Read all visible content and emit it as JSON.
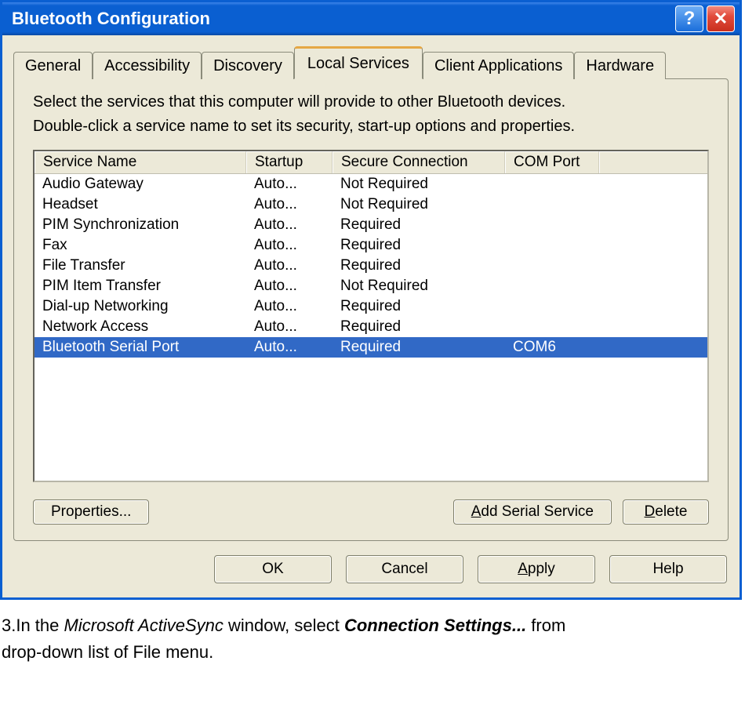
{
  "titlebar": {
    "title": "Bluetooth Configuration"
  },
  "tabs": {
    "general": "General",
    "accessibility": "Accessibility",
    "discovery": "Discovery",
    "local_services": "Local Services",
    "client_apps": "Client Applications",
    "hardware": "Hardware"
  },
  "panel": {
    "instruction1": "Select the services that this computer will provide to other Bluetooth devices.",
    "instruction2": "Double-click a service name to set its security, start-up options and properties.",
    "columns": {
      "name": "Service Name",
      "startup": "Startup",
      "secure": "Secure Connection",
      "port": "COM Port"
    },
    "services": [
      {
        "name": "Audio Gateway",
        "startup": "Auto...",
        "secure": "Not Required",
        "port": ""
      },
      {
        "name": "Headset",
        "startup": "Auto...",
        "secure": "Not Required",
        "port": ""
      },
      {
        "name": "PIM Synchronization",
        "startup": "Auto...",
        "secure": "Required",
        "port": ""
      },
      {
        "name": "Fax",
        "startup": "Auto...",
        "secure": "Required",
        "port": ""
      },
      {
        "name": "File Transfer",
        "startup": "Auto...",
        "secure": "Required",
        "port": ""
      },
      {
        "name": "PIM Item Transfer",
        "startup": "Auto...",
        "secure": "Not Required",
        "port": ""
      },
      {
        "name": "Dial-up Networking",
        "startup": "Auto...",
        "secure": "Required",
        "port": ""
      },
      {
        "name": "Network Access",
        "startup": "Auto...",
        "secure": "Required",
        "port": ""
      },
      {
        "name": "Bluetooth Serial Port",
        "startup": "Auto...",
        "secure": "Required",
        "port": "COM6",
        "selected": true
      }
    ],
    "buttons": {
      "properties": "Properties...",
      "add_serial": "Add Serial Service",
      "delete": "Delete"
    }
  },
  "dialog_buttons": {
    "ok": "OK",
    "cancel": "Cancel",
    "apply": "Apply",
    "help": "Help"
  },
  "caption": {
    "prefix": "3.In the ",
    "italic": "Microsoft ActiveSync",
    "mid": " window, select ",
    "bold": "Connection Settings...",
    "suffix1": " from",
    "suffix2": "drop-down list of File menu."
  }
}
